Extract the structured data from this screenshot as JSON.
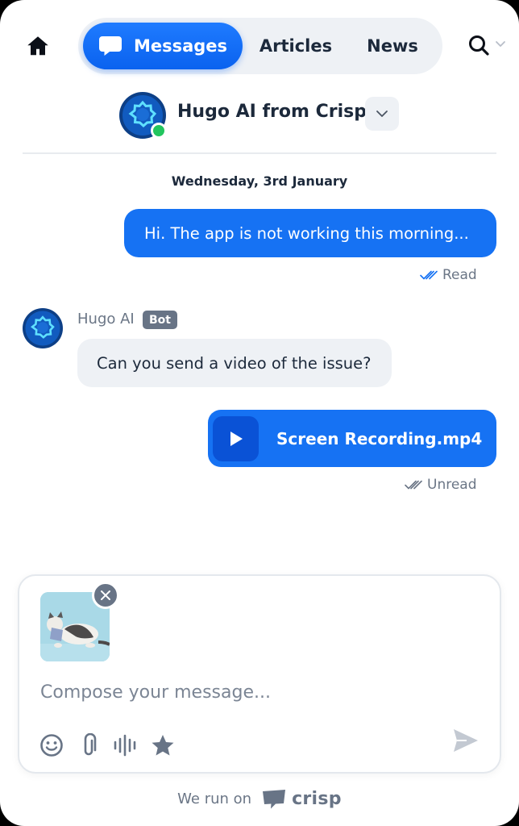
{
  "nav": {
    "home_icon": "home-icon",
    "tabs": [
      {
        "label": "Messages",
        "icon": "chat-bubble-icon",
        "active": true
      },
      {
        "label": "Articles",
        "active": false
      },
      {
        "label": "News",
        "active": false
      }
    ],
    "search_icon": "search-icon"
  },
  "operator": {
    "name": "Hugo AI from Crisp",
    "status": "online"
  },
  "conversation": {
    "date": "Wednesday, 3rd January",
    "messages": [
      {
        "from": "user",
        "text": "Hi. The app is not working this morning..."
      },
      {
        "status": "Read"
      },
      {
        "from": "bot",
        "sender": "Hugo AI",
        "badge": "Bot",
        "text": "Can you send a video of the issue?"
      },
      {
        "from": "user",
        "file": "Screen Recording.mp4"
      },
      {
        "status": "Unread"
      }
    ]
  },
  "composer": {
    "placeholder": "Compose your message...",
    "value": "",
    "tools": [
      "smiley-icon",
      "paperclip-icon",
      "audio-waveform-icon",
      "star-icon"
    ],
    "send_icon": "send-icon"
  },
  "footer": {
    "text": "We run on",
    "brand": "crisp"
  },
  "colors": {
    "accent": "#1672f3",
    "online": "#22c55e",
    "bot_badge": "#687486"
  }
}
